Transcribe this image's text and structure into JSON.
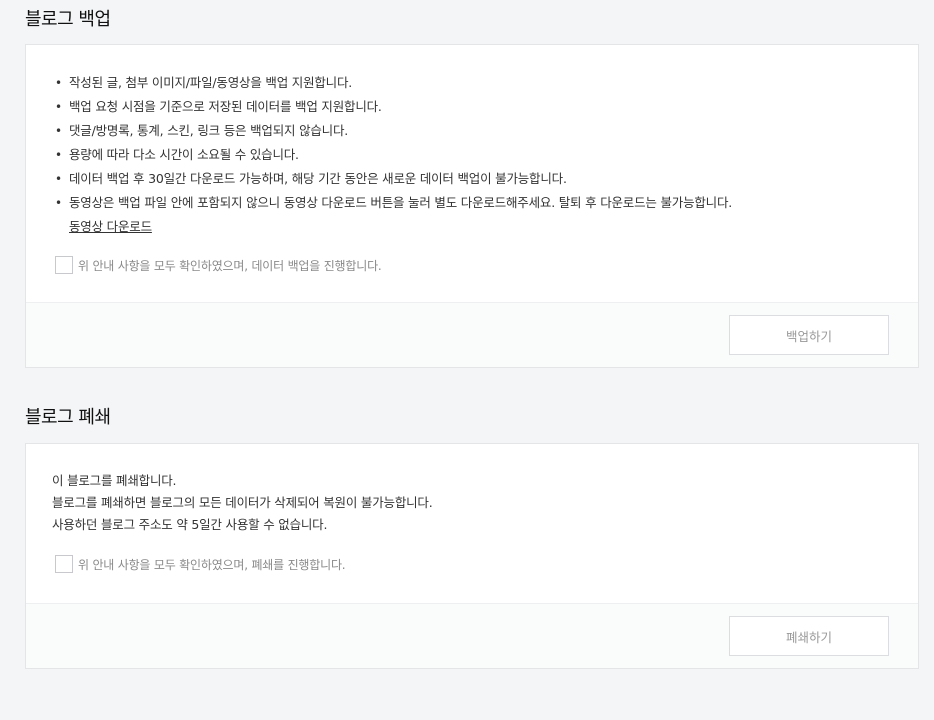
{
  "backup": {
    "title": "블로그 백업",
    "notices": [
      "작성된 글, 첨부 이미지/파일/동영상을 백업 지원합니다.",
      "백업 요청 시점을 기준으로 저장된 데이터를 백업 지원합니다.",
      "댓글/방명록, 통계, 스킨, 링크 등은 백업되지 않습니다.",
      "용량에 따라 다소 시간이 소요될 수 있습니다.",
      "데이터 백업 후 30일간 다운로드 가능하며, 해당 기간 동안은 새로운 데이터 백업이 불가능합니다.",
      "동영상은 백업 파일 안에 포함되지 않으니 동영상 다운로드 버튼을 눌러 별도 다운로드해주세요. 탈퇴 후 다운로드는 불가능합니다."
    ],
    "video_download_link": "동영상 다운로드",
    "agree_label": "위 안내 사항을 모두 확인하였으며, 데이터 백업을 진행합니다.",
    "agree_checked": false,
    "button_label": "백업하기"
  },
  "close": {
    "title": "블로그 폐쇄",
    "lines": [
      "이 블로그를 폐쇄합니다.",
      "블로그를 폐쇄하면 블로그의 모든 데이터가 삭제되어 복원이 불가능합니다.",
      "사용하던 블로그 주소도 약 5일간 사용할 수 없습니다."
    ],
    "agree_label": "위 안내 사항을 모두 확인하였으며, 폐쇄를 진행합니다.",
    "agree_checked": false,
    "button_label": "폐쇄하기"
  }
}
